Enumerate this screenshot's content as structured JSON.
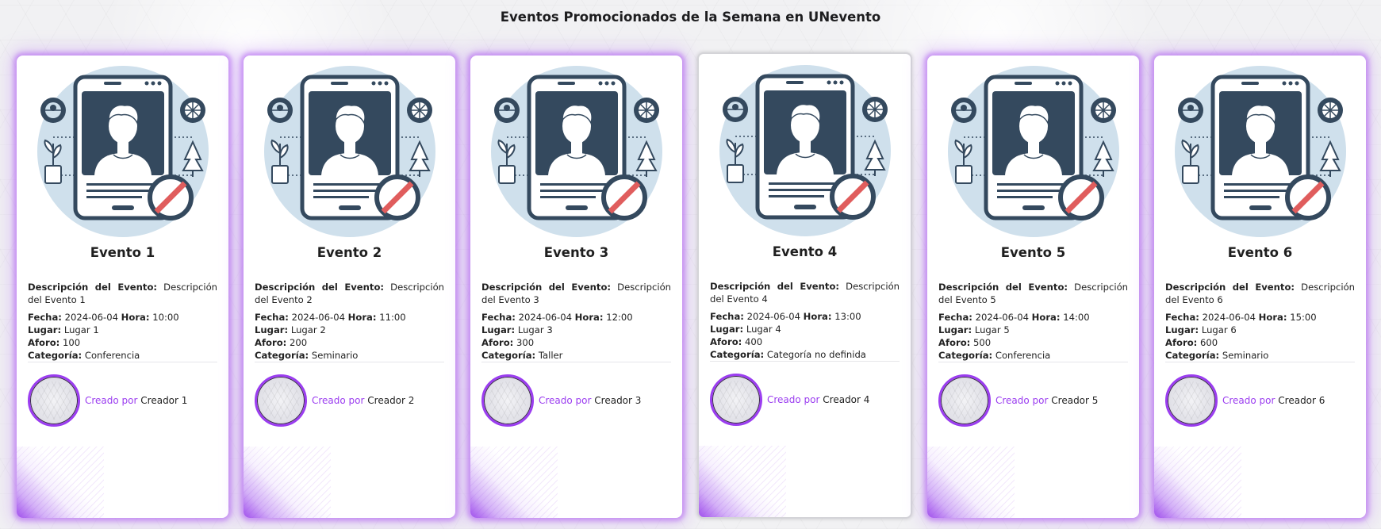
{
  "page": {
    "title": "Eventos Promocionados de la Semana en UNevento"
  },
  "labels": {
    "description": "Descripción del Evento:",
    "date": "Fecha:",
    "time": "Hora:",
    "place": "Lugar:",
    "capacity": "Aforo:",
    "category": "Categoría:",
    "created_by": "Creado por"
  },
  "events": [
    {
      "name": "Evento 1",
      "description": "Descripción del Evento 1",
      "date": "2024-06-04",
      "time": "10:00",
      "place": "Lugar 1",
      "capacity": "100",
      "category": "Conferencia",
      "creator": "Creador 1"
    },
    {
      "name": "Evento 2",
      "description": "Descripción del Evento 2",
      "date": "2024-06-04",
      "time": "11:00",
      "place": "Lugar 2",
      "capacity": "200",
      "category": "Seminario",
      "creator": "Creador 2"
    },
    {
      "name": "Evento 3",
      "description": "Descripción del Evento 3",
      "date": "2024-06-04",
      "time": "12:00",
      "place": "Lugar 3",
      "capacity": "300",
      "category": "Taller",
      "creator": "Creador 3"
    },
    {
      "name": "Evento 4",
      "description": "Descripción del Evento 4",
      "date": "2024-06-04",
      "time": "13:00",
      "place": "Lugar 4",
      "capacity": "400",
      "category": "Categoría no definida",
      "creator": "Creador 4"
    },
    {
      "name": "Evento 5",
      "description": "Descripción del Evento 5",
      "date": "2024-06-04",
      "time": "14:00",
      "place": "Lugar 5",
      "capacity": "500",
      "category": "Conferencia",
      "creator": "Creador 5"
    },
    {
      "name": "Evento 6",
      "description": "Descripción del Evento 6",
      "date": "2024-06-04",
      "time": "15:00",
      "place": "Lugar 6",
      "capacity": "600",
      "category": "Seminario",
      "creator": "Creador 6"
    }
  ],
  "icons": {
    "event_image": "no-image-placeholder-icon",
    "creator_avatar": "avatar-placeholder-icon"
  },
  "colors": {
    "accent": "#9b3df0",
    "glow": "#b060f0",
    "illustration_dark": "#34495e",
    "illustration_bg": "#cfe0ec",
    "no_sign": "#e05d5d"
  }
}
